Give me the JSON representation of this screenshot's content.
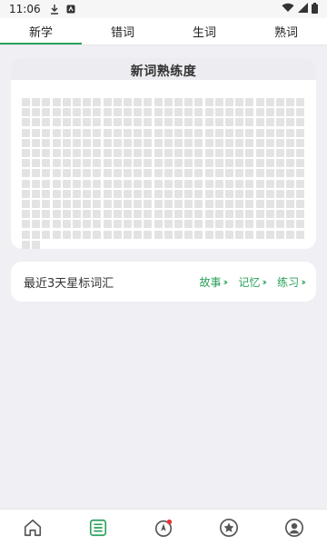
{
  "status_bar": {
    "time": "11:06",
    "icons": [
      "download-icon",
      "app-notification-icon",
      "wifi-icon",
      "signal-icon",
      "battery-icon"
    ]
  },
  "tabs": [
    {
      "label": "新学",
      "active": true
    },
    {
      "label": "错词",
      "active": false
    },
    {
      "label": "生词",
      "active": false
    },
    {
      "label": "熟词",
      "active": false
    }
  ],
  "proficiency": {
    "title": "新词熟练度",
    "grid_rows": 14,
    "grid_cols": 28,
    "extra_cells_last_row": 2
  },
  "starred": {
    "title": "最近3天星标词汇",
    "actions": [
      {
        "label": "故事"
      },
      {
        "label": "记忆"
      },
      {
        "label": "练习"
      }
    ]
  },
  "bottom_nav": [
    {
      "icon": "home-icon",
      "active": false
    },
    {
      "icon": "list-icon",
      "active": true
    },
    {
      "icon": "compass-icon",
      "active": false,
      "badge": true
    },
    {
      "icon": "star-icon",
      "active": false
    },
    {
      "icon": "user-icon",
      "active": false
    }
  ],
  "colors": {
    "accent": "#2aa15a",
    "background": "#efeff4",
    "cell": "#e3e3e3",
    "badge": "#e53935"
  }
}
